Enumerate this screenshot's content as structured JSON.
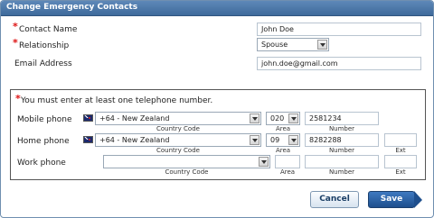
{
  "dialog": {
    "title": "Change Emergency Contacts"
  },
  "contact": {
    "name_label": "Contact Name",
    "name_value": "John Doe",
    "relationship_label": "Relationship",
    "relationship_value": "Spouse",
    "email_label": "Email Address",
    "email_value": "john.doe@gmail.com"
  },
  "phones": {
    "required_note": "You must enter at least one telephone number.",
    "sub_labels": {
      "country_code": "Country Code",
      "area": "Area",
      "number": "Number",
      "ext": "Ext"
    },
    "rows": [
      {
        "label": "Mobile phone",
        "country": "+64 - New Zealand",
        "area": "020",
        "number": "2581234",
        "ext": ""
      },
      {
        "label": "Home phone",
        "country": "+64 - New Zealand",
        "area": "09",
        "number": "8282288",
        "ext": ""
      },
      {
        "label": "Work phone",
        "country": "",
        "area": "",
        "number": "",
        "ext": ""
      }
    ]
  },
  "buttons": {
    "cancel": "Cancel",
    "save": "Save"
  },
  "icons": {
    "flag": "new-zealand-flag-icon",
    "dropdown": "chevron-down-icon",
    "required": "asterisk-icon"
  }
}
